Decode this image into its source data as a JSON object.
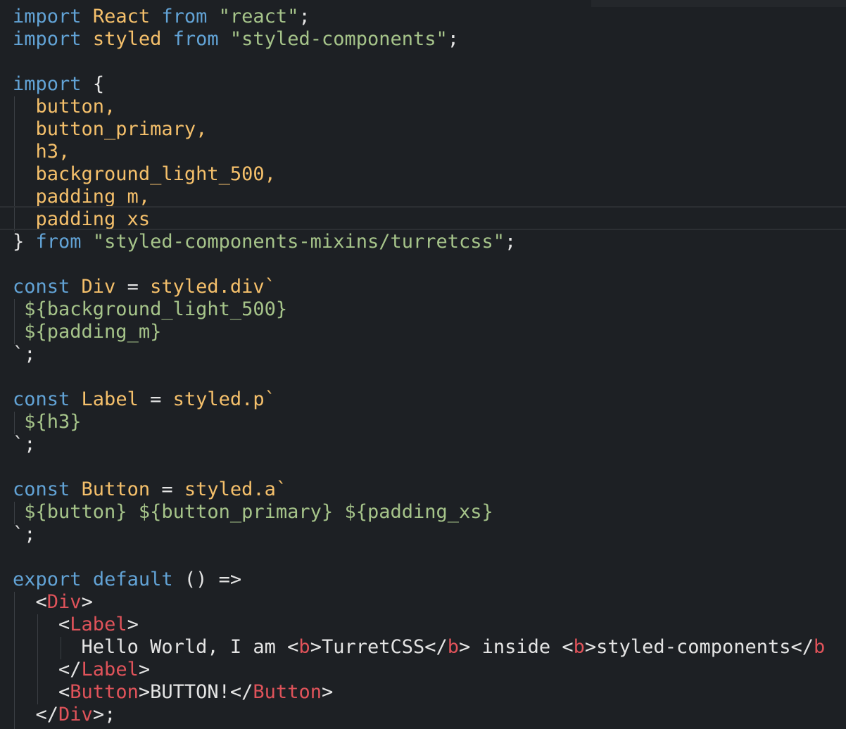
{
  "editor": {
    "language": "JavaScript (JSX)",
    "theme_colors": {
      "background": "#1d2024",
      "keyword": "#62a3d6",
      "identifier": "#f5c06b",
      "string": "#a6c48a",
      "tag": "#e0535a",
      "plain": "#e4e4e4"
    }
  },
  "code": {
    "l1": {
      "kw1": "import",
      "id": "React",
      "kw2": "from",
      "str": "\"react\"",
      "end": ";"
    },
    "l2": {
      "kw1": "import",
      "id": "styled",
      "kw2": "from",
      "str": "\"styled-components\"",
      "end": ";"
    },
    "l4": {
      "kw": "import",
      "brace": "{"
    },
    "l5": "button,",
    "l6": "button_primary,",
    "l7": "h3,",
    "l8": "background_light_500,",
    "l9": "padding_m,",
    "l10": "padding_xs",
    "l11": {
      "brace": "}",
      "kw": "from",
      "str": "\"styled-components-mixins/turretcss\"",
      "end": ";"
    },
    "l13": {
      "kw": "const",
      "id": "Div",
      "eq": "=",
      "call": "styled.div`"
    },
    "l14": "${background_light_500}",
    "l15": "${padding_m}",
    "l16": "`;",
    "l18": {
      "kw": "const",
      "id": "Label",
      "eq": "=",
      "call": "styled.p`"
    },
    "l19": "${h3}",
    "l20": "`;",
    "l22": {
      "kw": "const",
      "id": "Button",
      "eq": "=",
      "call": "styled.a`"
    },
    "l23": {
      "a": "${button}",
      "b": "${button_primary}",
      "c": "${padding_xs}"
    },
    "l24": "`;",
    "l26": {
      "kw1": "export",
      "kw2": "default",
      "rest": "() =>"
    },
    "l27": {
      "open": "<",
      "tag": "Div",
      "close": ">"
    },
    "l28": {
      "open": "<",
      "tag": "Label",
      "close": ">"
    },
    "l29": {
      "t1": "Hello World, I am ",
      "b1o": "<",
      "b1t": "b",
      "b1c": ">",
      "t2": "TurretCSS",
      "b2o": "</",
      "b2t": "b",
      "b2c": ">",
      "t3": " inside ",
      "b3o": "<",
      "b3t": "b",
      "b3c": ">",
      "t4": "styled-components",
      "b4o": "</",
      "b4t": "b"
    },
    "l30": {
      "open": "</",
      "tag": "Label",
      "close": ">"
    },
    "l31": {
      "o1": "<",
      "tag1": "Button",
      "c1": ">",
      "text": "BUTTON!",
      "o2": "</",
      "tag2": "Button",
      "c2": ">"
    },
    "l32": {
      "open": "</",
      "tag": "Div",
      "close": ">",
      "end": ";"
    }
  }
}
